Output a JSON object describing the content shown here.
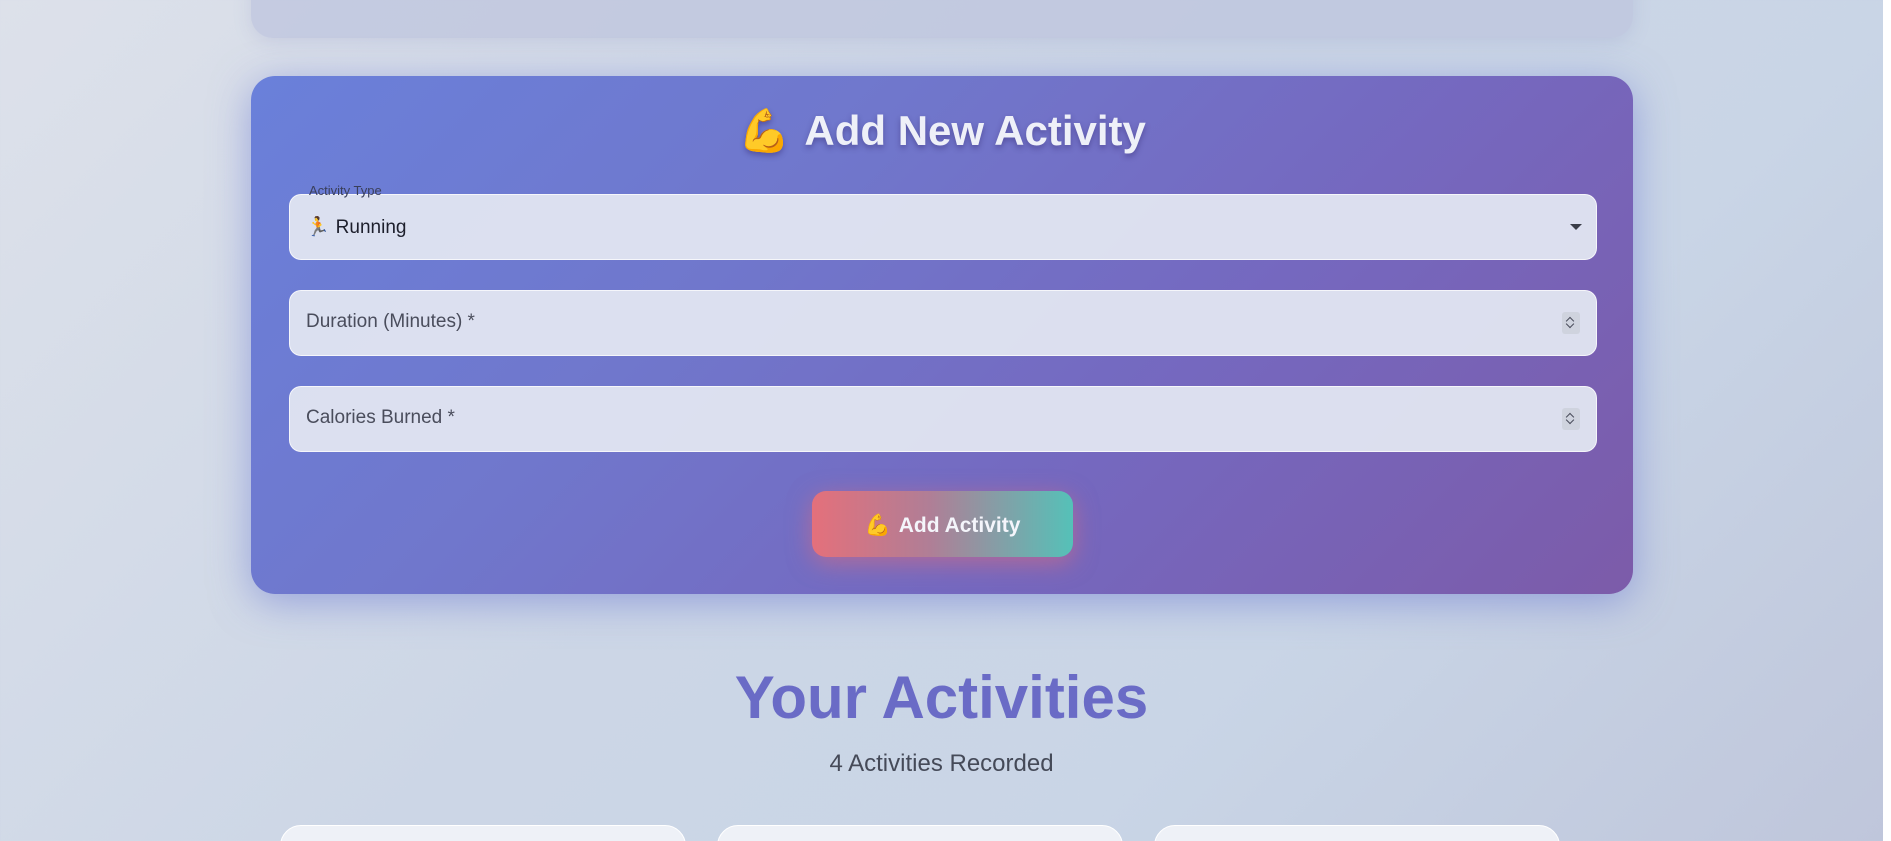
{
  "form": {
    "title_emoji": "💪",
    "title": "Add New Activity",
    "activity_type": {
      "label": "Activity Type",
      "emoji": "🏃",
      "selected": "Running"
    },
    "duration": {
      "placeholder": "Duration (Minutes) *"
    },
    "calories": {
      "placeholder": "Calories Burned *"
    },
    "submit": {
      "emoji": "💪",
      "label": "Add Activity"
    }
  },
  "activities": {
    "title": "Your Activities",
    "count_text": "4 Activities Recorded"
  },
  "icons": {
    "select_caret": "chevron-down-icon",
    "number_spinner": "spinner-icon"
  },
  "colors": {
    "form_gradient_start": "#6a80da",
    "form_gradient_end": "#7c5ba9",
    "button_gradient_start": "#e4707b",
    "button_gradient_end": "#55c1b8",
    "section_title": "#6a6bc6"
  }
}
